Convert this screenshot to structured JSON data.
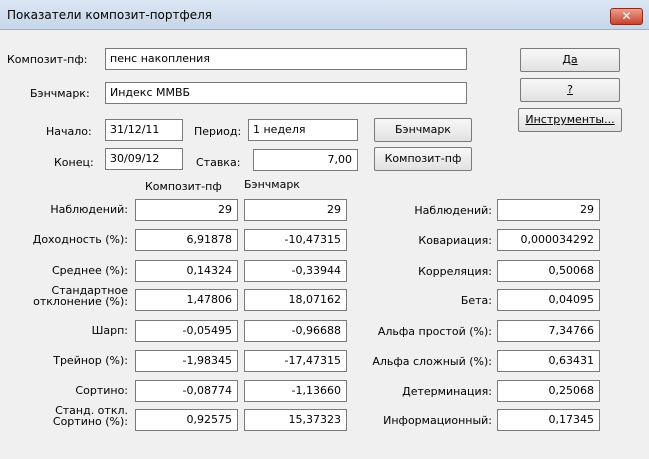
{
  "window": {
    "title": "Показатели композит-портфеля",
    "close_glyph": "✕"
  },
  "form": {
    "composite_label": "Композит-пф:",
    "composite_value": "пенс накопления",
    "benchmark_label": "Бэнчмарк:",
    "benchmark_value": "Индекс ММВБ",
    "start_label": "Начало:",
    "start_value": "31/12/11",
    "period_label": "Период:",
    "period_value": "1 неделя",
    "end_label": "Конец:",
    "end_value": "30/09/12",
    "rate_label": "Ставка:",
    "rate_value": "7,00"
  },
  "buttons": {
    "ok": "Да",
    "help": "?",
    "tools": "Инструменты...",
    "benchmark": "Бэнчмарк",
    "composite": "Композит-пф"
  },
  "table": {
    "col_composite": "Композит-пф",
    "col_benchmark": "Бэнчмарк",
    "rows": [
      {
        "label": "Наблюдений:",
        "composite": "29",
        "benchmark": "29"
      },
      {
        "label": "Доходность (%):",
        "composite": "6,91878",
        "benchmark": "-10,47315"
      },
      {
        "label": "Среднее (%):",
        "composite": "0,14324",
        "benchmark": "-0,33944"
      },
      {
        "label": "Стандартное\nотклонение (%):",
        "composite": "1,47806",
        "benchmark": "18,07162"
      },
      {
        "label": "Шарп:",
        "composite": "-0,05495",
        "benchmark": "-0,96688"
      },
      {
        "label": "Трейнор (%):",
        "composite": "-1,98345",
        "benchmark": "-17,47315"
      },
      {
        "label": "Сортино:",
        "composite": "-0,08774",
        "benchmark": "-1,13660"
      },
      {
        "label": "Станд. откл.\nСортино (%):",
        "composite": "0,92575",
        "benchmark": "15,37323"
      }
    ]
  },
  "stats": [
    {
      "label": "Наблюдений:",
      "value": "29"
    },
    {
      "label": "Ковариация:",
      "value": "0,000034292"
    },
    {
      "label": "Корреляция:",
      "value": "0,50068"
    },
    {
      "label": "Бета:",
      "value": "0,04095"
    },
    {
      "label": "Альфа простой (%):",
      "value": "7,34766"
    },
    {
      "label": "Альфа сложный (%):",
      "value": "0,63431"
    },
    {
      "label": "Детерминация:",
      "value": "0,25068"
    },
    {
      "label": "Информационный:",
      "value": "0,17345"
    }
  ]
}
